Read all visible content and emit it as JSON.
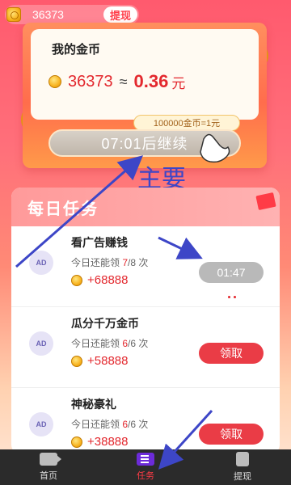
{
  "header": {
    "coins": "36373",
    "withdraw_label": "提现"
  },
  "gold_card": {
    "title": "我的金币",
    "coins": "36373",
    "approx": "≈",
    "yuan_value": "0.36",
    "yuan_unit": "元",
    "rate": "100000金币=1元",
    "continue_label": "07:01后继续"
  },
  "annotation": {
    "text": "主要"
  },
  "tasks": {
    "title": "每日任务",
    "items": [
      {
        "name": "看广告赚钱",
        "count_prefix": "今日还能领",
        "count_current": "7",
        "count_total": "/8 次",
        "reward": "+68888",
        "button": "01:47"
      },
      {
        "name": "瓜分千万金币",
        "count_prefix": "今日还能领",
        "count_current": "6",
        "count_total": "/6 次",
        "reward": "+58888",
        "button": "领取"
      },
      {
        "name": "神秘豪礼",
        "count_prefix": "今日还能领",
        "count_current": "6",
        "count_total": "/6 次",
        "reward": "+38888",
        "button": "领取"
      }
    ],
    "ad_label": "AD"
  },
  "bottom_nav": {
    "home": "首页",
    "tasks": "任务",
    "withdraw": "提现",
    "active": "tasks"
  },
  "colors": {
    "accent_red": "#e3282e",
    "annotation_blue": "#3d46c7"
  }
}
